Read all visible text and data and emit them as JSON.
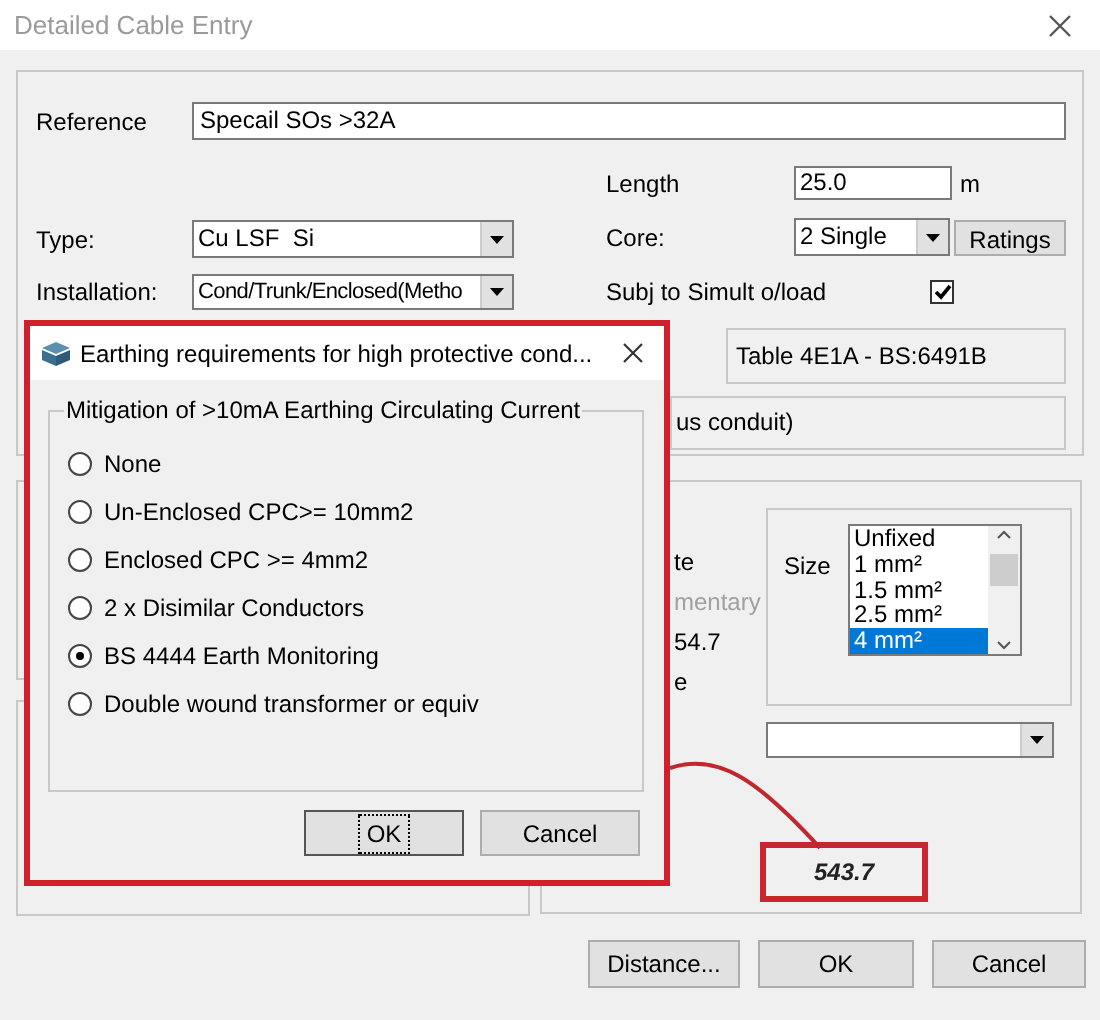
{
  "window": {
    "title": "Detailed Cable Entry"
  },
  "cable": {
    "reference": {
      "label": "Reference",
      "value": "Specail SOs >32A"
    },
    "length": {
      "label": "Length",
      "value": "25.0",
      "unit": "m"
    },
    "type": {
      "label": "Type:",
      "value": "Cu LSF  Si"
    },
    "core": {
      "label": "Core:",
      "value": "2 Single"
    },
    "ratings_button": "Ratings",
    "installation": {
      "label": "Installation:",
      "value": "Cond/Trunk/Enclosed(Metho"
    },
    "simult_overload": {
      "label": "Subj to Simult o/load",
      "checked": true
    },
    "table_ref": "Table 4E1A - BS:6491B",
    "installation_detail": "us conduit)"
  },
  "results": {
    "fragments": [
      {
        "text": "te",
        "disabled": false
      },
      {
        "text": "mentary",
        "disabled": true
      },
      {
        "text": "54.7",
        "disabled": false
      },
      {
        "text": "e",
        "disabled": false
      }
    ],
    "size": {
      "label": "Size",
      "options": [
        {
          "label": "Unfixed",
          "selected": false
        },
        {
          "label": "1 mm²",
          "selected": false
        },
        {
          "label": "1.5 mm²",
          "selected": false
        },
        {
          "label": "2.5 mm²",
          "selected": false
        },
        {
          "label": "4 mm²",
          "selected": true
        }
      ]
    },
    "highlighted_value": "543.7"
  },
  "buttons": [
    {
      "label": "Distance..."
    },
    {
      "label": "OK"
    },
    {
      "label": "Cancel"
    }
  ],
  "modal": {
    "title": "Earthing requirements for high protective cond...",
    "group_label": "Mitigation of >10mA Earthing Circulating Current",
    "options": [
      {
        "label": "None",
        "selected": false
      },
      {
        "label": "Un-Enclosed CPC>= 10mm2",
        "selected": false
      },
      {
        "label": "Enclosed CPC >= 4mm2",
        "selected": false
      },
      {
        "label": "2 x Disimilar Conductors",
        "selected": false
      },
      {
        "label": "BS 4444 Earth Monitoring",
        "selected": true
      },
      {
        "label": "Double wound transformer or equiv",
        "selected": false
      }
    ],
    "buttons": [
      {
        "label": "OK",
        "focused": true
      },
      {
        "label": "Cancel",
        "focused": false
      }
    ]
  }
}
